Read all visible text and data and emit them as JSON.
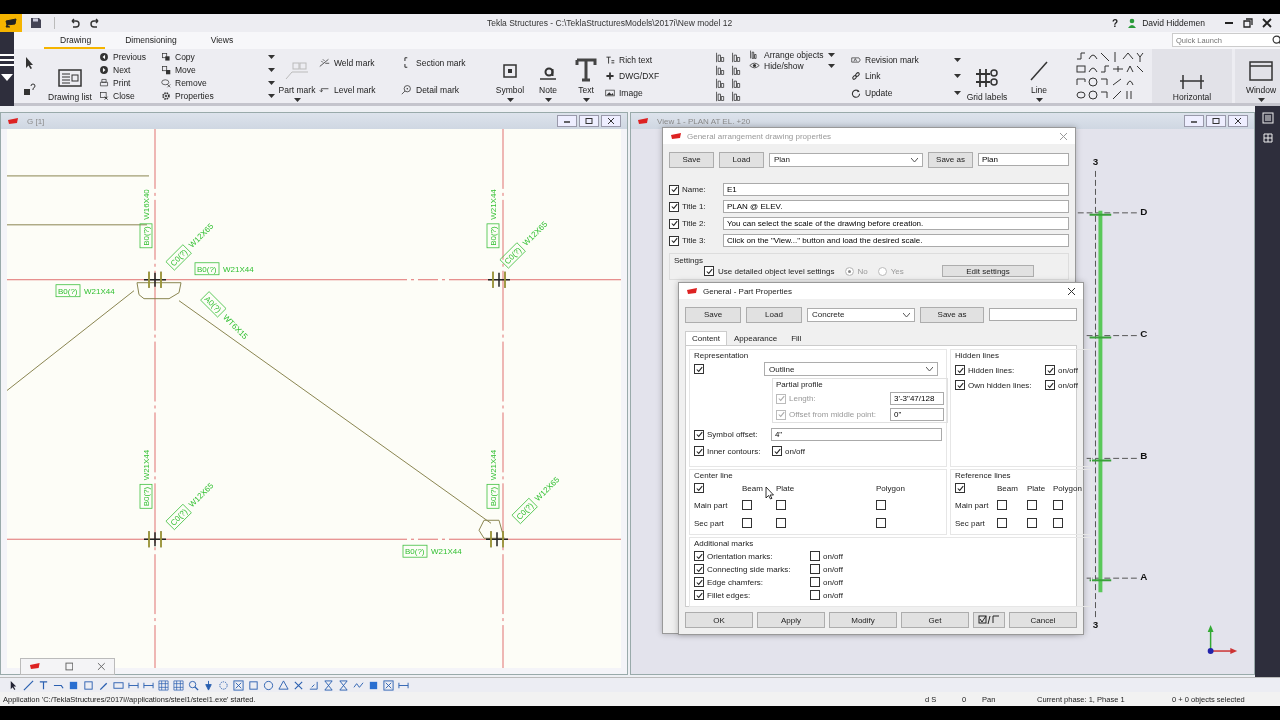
{
  "titlebar": {
    "title": "Tekla Structures - C:\\TeklaStructuresModels\\2017i\\New model 12",
    "help": "?",
    "user": "David Hiddemen"
  },
  "ribbon_tabs": [
    {
      "label": "Drawing",
      "selected": true
    },
    {
      "label": "Dimensioning",
      "selected": false
    },
    {
      "label": "Views",
      "selected": false
    }
  ],
  "quick_launch": {
    "placeholder": "Quick Launch"
  },
  "ribbon": {
    "drawing_list": "Drawing list",
    "navigate": [
      "Previous",
      "Next",
      "Print",
      "Close"
    ],
    "edit": [
      "Copy",
      "Move",
      "Remove",
      "Properties"
    ],
    "part_mark": "Part mark",
    "marks_1": [
      "Weld mark",
      "Level mark"
    ],
    "marks_2": [
      "Section mark",
      "Detail mark"
    ],
    "annotate": [
      "Symbol",
      "Note",
      "Text"
    ],
    "insert": [
      "Rich text",
      "DWG/DXF",
      "Image"
    ],
    "arrange": [
      "Arrange objects",
      "Hide/show"
    ],
    "revision": [
      "Revision mark",
      "Link",
      "Update"
    ],
    "tools": [
      "Grid labels",
      "Line"
    ],
    "horizontal": "Horizontal",
    "window": "Window"
  },
  "left_window": {
    "title": "G  [1]",
    "labels": [
      {
        "mark": "B0(?)",
        "profile": "W16X40"
      },
      {
        "mark": "C0(?)",
        "profile": "W12X65"
      },
      {
        "mark": "B0(?)",
        "profile": "W21X44"
      },
      {
        "mark": "B0(?)",
        "profile": "W21X44"
      },
      {
        "mark": "A0(?)",
        "profile": "WT6X15"
      },
      {
        "mark": "B0(?)",
        "profile": "W21X44"
      },
      {
        "mark": "C0(?)",
        "profile": "W12X65"
      },
      {
        "mark": "B0(?)",
        "profile": "W21X44"
      },
      {
        "mark": "C0(?)",
        "profile": "W12X65"
      },
      {
        "mark": "B0(?)",
        "profile": "W21X44"
      },
      {
        "mark": "C0(?)",
        "profile": "W12X65"
      },
      {
        "mark": "B0(?)",
        "profile": "W21X44"
      }
    ]
  },
  "right_window": {
    "title": "View 1 - PLAN AT EL. +20",
    "grid_labels": [
      "3",
      "D",
      "C",
      "B",
      "A",
      "3"
    ]
  },
  "drawing_dialog": {
    "title": "General arrangement drawing properties",
    "save": "Save",
    "load": "Load",
    "preset": "Plan",
    "save_as": "Save as",
    "save_as_name": "Plan",
    "fields": [
      {
        "label": "Name:",
        "checked": true,
        "value": "E1"
      },
      {
        "label": "Title 1:",
        "checked": true,
        "value": "PLAN @ ELEV."
      },
      {
        "label": "Title 2:",
        "checked": true,
        "value": "You can select the scale of the drawing before creation."
      },
      {
        "label": "Title 3:",
        "checked": true,
        "value": "Click on the \"View...\" button and load the desired scale."
      }
    ],
    "settings": {
      "heading": "Settings",
      "label": "Use detailed object level settings",
      "checked": true,
      "options": [
        {
          "label": "No",
          "selected": true
        },
        {
          "label": "Yes",
          "selected": false
        }
      ],
      "edit": "Edit settings"
    }
  },
  "part_dialog": {
    "title": "General - Part Properties",
    "save": "Save",
    "load": "Load",
    "preset": "Concrete",
    "save_as": "Save as",
    "tabs": [
      {
        "label": "Content",
        "selected": true
      },
      {
        "label": "Appearance",
        "selected": false
      },
      {
        "label": "Fill",
        "selected": false
      }
    ],
    "representation": {
      "heading": "Representation",
      "checked": true,
      "value": "Outline",
      "partial_heading": "Partial profile",
      "partial": [
        {
          "label": "Length:",
          "checked": true,
          "disabled": true,
          "value": "3'-3\"47/128"
        },
        {
          "label": "Offset from middle point:",
          "checked": true,
          "disabled": true,
          "value": "0\""
        }
      ],
      "symbol_offset": {
        "label": "Symbol offset:",
        "checked": true,
        "value": "4\""
      },
      "inner_contours": {
        "label": "Inner contours:",
        "checked": true,
        "toggle": "on/off",
        "toggle_checked": true
      }
    },
    "hidden_lines": {
      "heading": "Hidden lines",
      "rows": [
        {
          "label": "Hidden lines:",
          "checked": true,
          "toggle": "on/off",
          "toggle_checked": true
        },
        {
          "label": "Own hidden lines:",
          "checked": true,
          "toggle": "on/off",
          "toggle_checked": true
        }
      ]
    },
    "center_line": {
      "heading": "Center line",
      "checked": true,
      "columns": [
        "Beam",
        "Plate",
        "Polygon"
      ],
      "rows": [
        {
          "label": "Main part",
          "checks": [
            false,
            false,
            false
          ]
        },
        {
          "label": "Sec part",
          "checks": [
            false,
            false,
            false
          ]
        }
      ]
    },
    "reference_lines": {
      "heading": "Reference lines",
      "checked": true,
      "columns": [
        "Beam",
        "Plate",
        "Polygon"
      ],
      "rows": [
        {
          "label": "Main part",
          "checks": [
            false,
            false,
            false
          ]
        },
        {
          "label": "Sec part",
          "checks": [
            false,
            false,
            false
          ]
        }
      ]
    },
    "additional_marks": {
      "heading": "Additional marks",
      "rows": [
        {
          "label": "Orientation marks:",
          "checked": true,
          "toggle": "on/off",
          "toggle_checked": false
        },
        {
          "label": "Connecting side marks:",
          "checked": true,
          "toggle": "on/off",
          "toggle_checked": false
        },
        {
          "label": "Edge chamfers:",
          "checked": true,
          "toggle": "on/off",
          "toggle_checked": false
        },
        {
          "label": "Fillet edges:",
          "checked": true,
          "toggle": "on/off",
          "toggle_checked": false
        }
      ]
    },
    "buttons": [
      "OK",
      "Apply",
      "Modify",
      "Get"
    ],
    "cancel": "Cancel"
  },
  "status_bar": {
    "message": "Application 'C:/TeklaStructures/2017i//applications/steel1/steel1.exe' started.",
    "snap": "d S",
    "count": "0",
    "mode": "Pan",
    "phase": "Current phase: 1, Phase 1",
    "selection": "0 + 0 objects selected"
  }
}
